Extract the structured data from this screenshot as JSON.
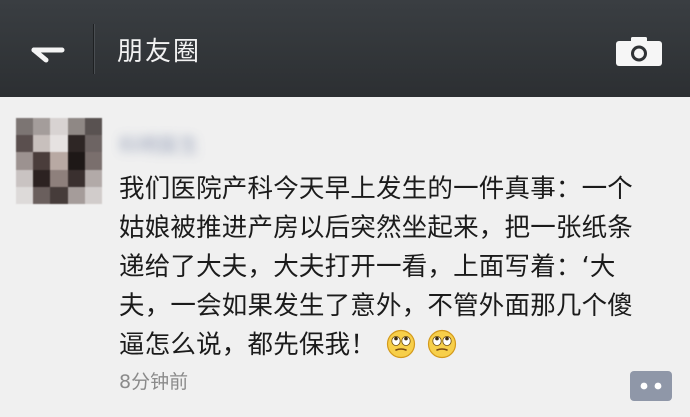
{
  "header": {
    "back_icon": "back-arrow-icon",
    "title": "朋友圈",
    "camera_icon": "camera-icon"
  },
  "post": {
    "author": "科明医生",
    "avatar": "pixelated-avatar",
    "lines": [
      "我们医院产科今天早上发生的一件真事：一个",
      "姑娘被推进产房以后突然坐起来，把一张纸条",
      "递给了大夫，大夫打开一看，上面写着：‘大",
      "夫，一会如果发生了意外，不管外面那几个傻",
      "逼怎么说，都先保我！"
    ],
    "emojis": [
      "rolling-eyes-emoji",
      "rolling-eyes-emoji"
    ],
    "time": "8分钟前",
    "comment_icon": "comment-icon"
  },
  "colors": {
    "topbar": "#2f3235",
    "post_bg": "#f0f0f0",
    "nickname": "#576b95",
    "timestamp": "#8a8a8a"
  }
}
